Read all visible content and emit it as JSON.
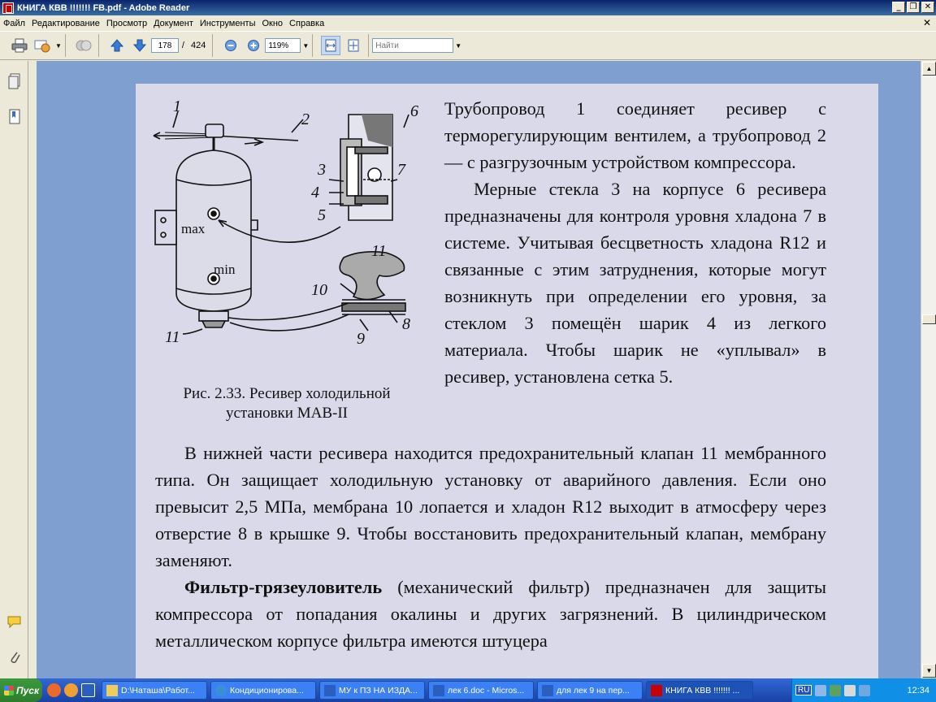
{
  "window": {
    "title": "КНИГА КВВ !!!!!!! FB.pdf - Adobe Reader",
    "menu": [
      "Файл",
      "Редактирование",
      "Просмотр",
      "Документ",
      "Инструменты",
      "Окно",
      "Справка"
    ]
  },
  "toolbar": {
    "current_page": "178",
    "page_separator": "/",
    "total_pages": "424",
    "zoom": "119%",
    "find_placeholder": "Найти"
  },
  "figure": {
    "labels": [
      "1",
      "2",
      "3",
      "4",
      "5",
      "6",
      "7",
      "8",
      "9",
      "10",
      "11",
      "11",
      "max",
      "min"
    ],
    "caption_line1": "Рис. 2.33. Ресивер холодильной",
    "caption_line2": "установки МАВ-II"
  },
  "document": {
    "right_paragraph_1": "Трубопровод 1 соединяет ресивер с терморегулирующим вентилем, а трубопровод 2 — с разгрузочным устройством компрессора.",
    "right_paragraph_2": "Мерные стекла 3 на корпусе 6 ресивера предназначены для контроля уровня хладона 7 в системе. Учитывая бесцветность хладона R12 и связанные с этим затруднения, которые могут возникнуть при определении его уровня, за стеклом 3 помещён шарик 4 из легкого материала. Чтобы шарик не «уплывал» в ресивер, установлена сетка 5.",
    "paragraph_3": "В нижней части ресивера находится предохранительный клапан 11 мембранного типа. Он защищает холодильную установку от аварийного давления. Если оно превысит 2,5 МПа, мембрана 10 лопается и хладон R12 выходит в атмосферу через отверстие 8 в крышке 9. Чтобы восстановить предохранительный клапан, мембрану заменяют.",
    "paragraph_4_bold": "Фильтр-грязеуловитель",
    "paragraph_4_rest": " (механический фильтр) предназначен для защиты компрессора от попадания окалины и других загрязнений. В цилиндрическом металлическом корпусе фильтра имеются штуцера"
  },
  "taskbar": {
    "start_label": "Пуск",
    "tasks": [
      "D:\\Наташа\\Работ...",
      "Кондиционирова...",
      "МУ к ПЗ НА ИЗДА...",
      "лек 6.doc - Micros...",
      "для лек 9 на пер...",
      "КНИГА КВВ !!!!!!! ..."
    ],
    "language": "RU",
    "clock": "12:34"
  }
}
